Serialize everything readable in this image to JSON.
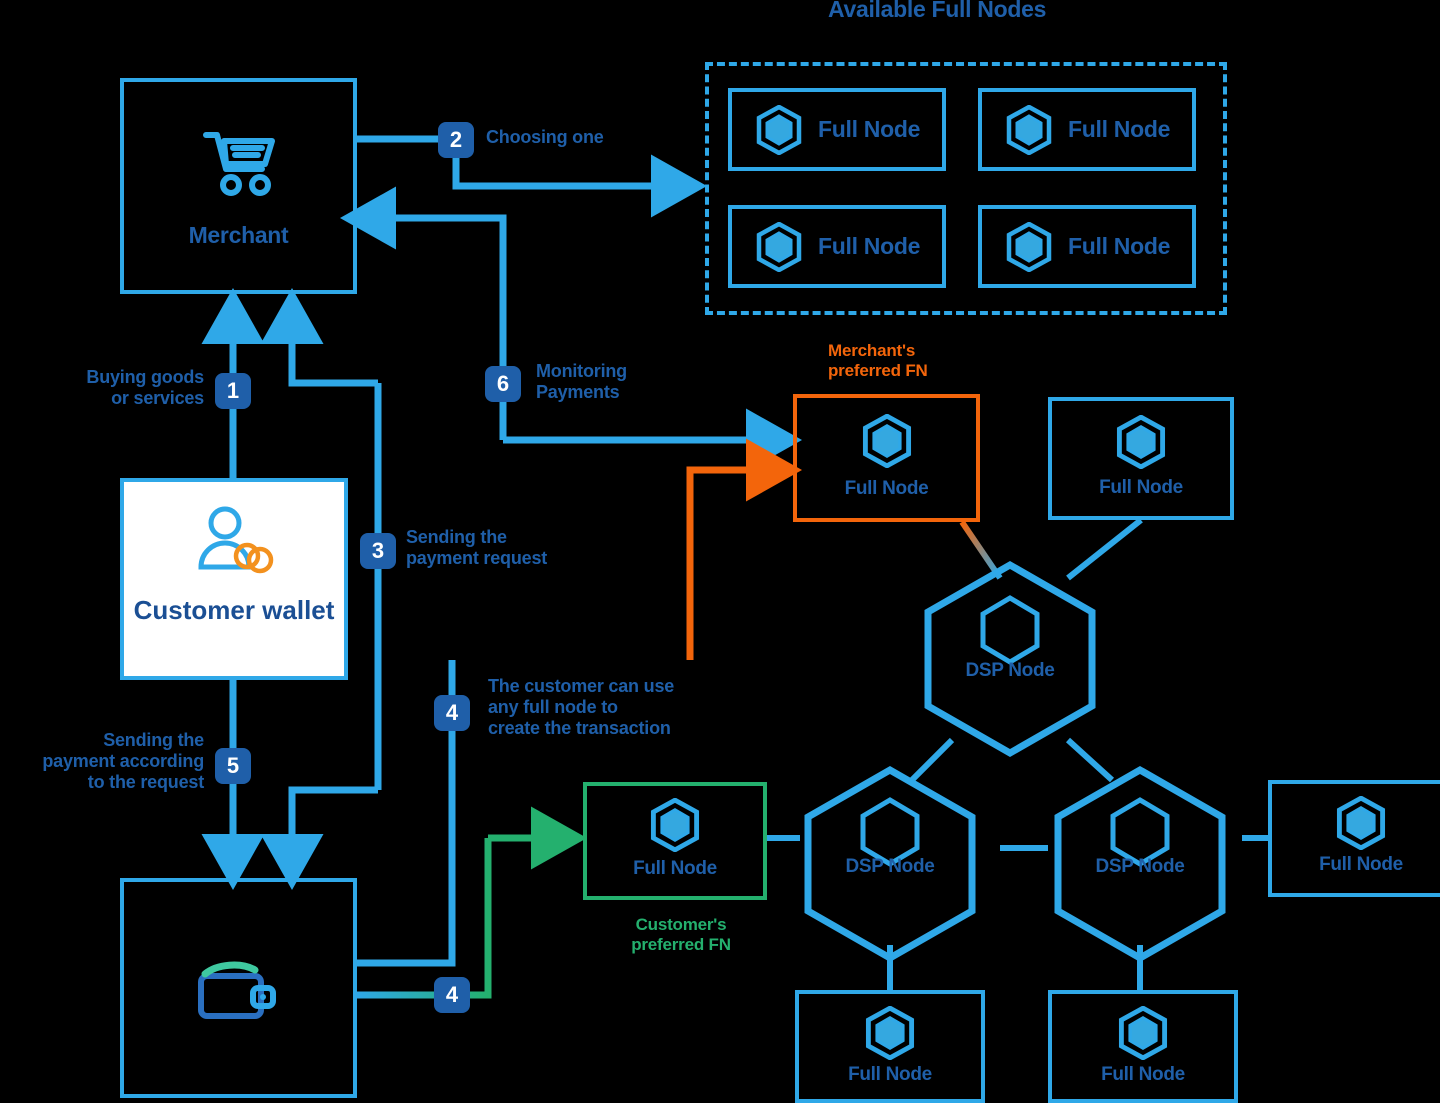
{
  "diagram": {
    "title": "Available Full Nodes",
    "colors": {
      "blue": "#2fa8e8",
      "dark_blue": "#1f5fa9",
      "orange": "#f3650b",
      "green": "#24b06e",
      "white": "#ffffff"
    }
  },
  "actors": {
    "merchant": {
      "label": "Merchant",
      "icon": "shopping-cart-icon"
    },
    "customer_wallet": {
      "label": "Customer wallet",
      "icon": "customer-coins-icon"
    },
    "wallet_box": {
      "label": "",
      "icon": "wallet-icon"
    }
  },
  "steps": [
    {
      "number": "1",
      "label": "Buying goods\nor services"
    },
    {
      "number": "2",
      "label": "Choosing one"
    },
    {
      "number": "3",
      "label": "Sending the\npayment request"
    },
    {
      "number": "4",
      "label": "The customer can use\nany full node to\ncreate the transaction"
    },
    {
      "number": "4",
      "label": ""
    },
    {
      "number": "5",
      "label": "Sending the\npayment according\nto the request"
    },
    {
      "number": "6",
      "label": "Monitoring\nPayments"
    }
  ],
  "step_labels": {
    "s1": "Buying goods\nor services",
    "s1_l1": "Buying goods",
    "s1_l2": "or services",
    "s2": "Choosing one",
    "s3_l1": "Sending the",
    "s3_l2": "payment request",
    "s4_l1": "The customer can use",
    "s4_l2": "any full node to",
    "s4_l3": "create the transaction",
    "s5_l1": "Sending the",
    "s5_l2": "payment according",
    "s5_l3": "to the request",
    "s6_l1": "Monitoring",
    "s6_l2": "Payments"
  },
  "available_pool": {
    "title": "Available Full Nodes",
    "nodes": [
      {
        "label": "Full Node",
        "icon": "hex-node-icon"
      },
      {
        "label": "Full Node",
        "icon": "hex-node-icon"
      },
      {
        "label": "Full Node",
        "icon": "hex-node-icon"
      },
      {
        "label": "Full Node",
        "icon": "hex-node-icon"
      }
    ]
  },
  "network": {
    "merchant_preferred": {
      "caption_l1": "Merchant's",
      "caption_l2": "preferred FN",
      "node_label": "Full Node"
    },
    "customer_preferred": {
      "caption_l1": "Customer's",
      "caption_l2": "preferred FN",
      "node_label": "Full Node"
    },
    "full_nodes": [
      {
        "label": "Full Node",
        "position": "top-right"
      },
      {
        "label": "Full Node",
        "position": "far-right"
      },
      {
        "label": "Full Node",
        "position": "bottom-left"
      },
      {
        "label": "Full Node",
        "position": "bottom-right"
      }
    ],
    "dsp_nodes": [
      {
        "label": "DSP Node",
        "position": "top"
      },
      {
        "label": "DSP Node",
        "position": "bottom-left"
      },
      {
        "label": "DSP Node",
        "position": "bottom-right"
      }
    ]
  }
}
